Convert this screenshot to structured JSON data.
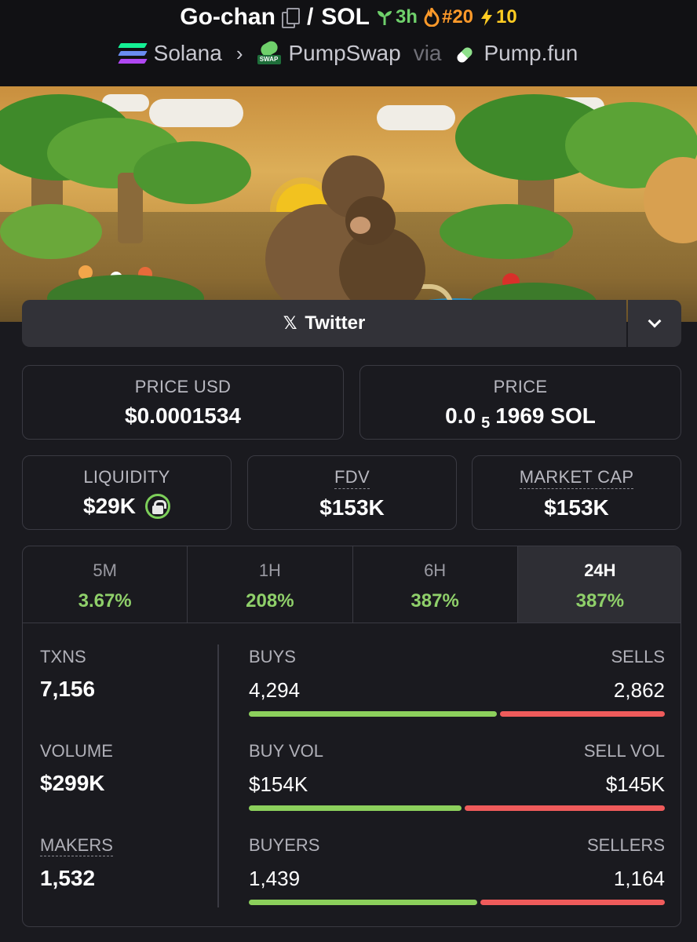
{
  "header": {
    "token_name": "Go-chan",
    "quote": "SOL",
    "age": "3h",
    "trending_rank": "#20",
    "boosts": "10",
    "chain": "Solana",
    "dex": "PumpSwap",
    "via": "via",
    "launchpad": "Pump.fun"
  },
  "links": {
    "twitter_label": "Twitter"
  },
  "prices": {
    "price_usd_label": "PRICE USD",
    "price_usd": "$0.0001534",
    "price_label": "PRICE",
    "price_prefix": "0.0",
    "price_zeros": "5",
    "price_suffix": "1969 SOL"
  },
  "metrics": {
    "liquidity_label": "LIQUIDITY",
    "liquidity": "$29K",
    "fdv_label": "FDV",
    "fdv": "$153K",
    "mcap_label": "MARKET CAP",
    "mcap": "$153K"
  },
  "periods": [
    {
      "label": "5M",
      "change": "3.67%",
      "active": false
    },
    {
      "label": "1H",
      "change": "208%",
      "active": false
    },
    {
      "label": "6H",
      "change": "387%",
      "active": false
    },
    {
      "label": "24H",
      "change": "387%",
      "active": true
    }
  ],
  "stats": {
    "txns_label": "TXNS",
    "txns": "7,156",
    "volume_label": "VOLUME",
    "volume": "$299K",
    "makers_label": "MAKERS",
    "makers": "1,532",
    "buys_label": "BUYS",
    "buys": "4,294",
    "sells_label": "SELLS",
    "sells": "2,862",
    "buys_share": 0.6,
    "buy_vol_label": "BUY VOL",
    "buy_vol": "$154K",
    "sell_vol_label": "SELL VOL",
    "sell_vol": "$145K",
    "buy_vol_share": 0.515,
    "buyers_label": "BUYERS",
    "buyers": "1,439",
    "sellers_label": "SELLERS",
    "sellers": "1,164",
    "buyers_share": 0.553
  },
  "colors": {
    "positive": "#8fd06a",
    "buy_bar": "#8cd05c",
    "sell_bar": "#ef5b5b",
    "age_green": "#6fd06b",
    "rank_orange": "#ff9a2a",
    "boost_yellow": "#ffcc22"
  },
  "icons": [
    "copy-icon",
    "seedling-icon",
    "fire-icon",
    "bolt-icon",
    "solana-icon",
    "pumpswap-icon",
    "pill-icon",
    "x-icon",
    "chevron-down-icon",
    "lock-icon"
  ]
}
